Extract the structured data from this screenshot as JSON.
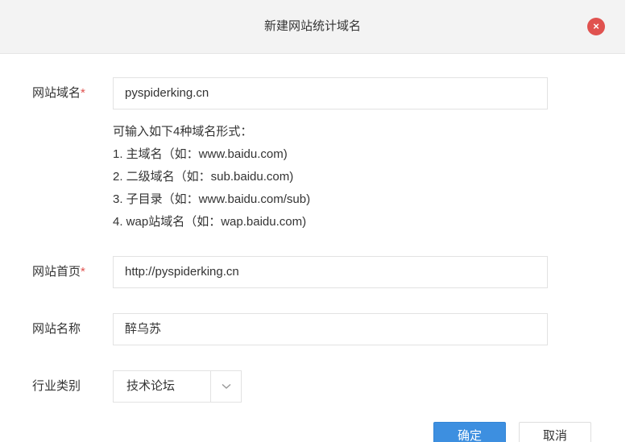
{
  "dialog": {
    "title": "新建网站统计域名",
    "close_label": "×"
  },
  "form": {
    "domain": {
      "label": "网站域名",
      "required_mark": "*",
      "value": "pyspiderking.cn"
    },
    "hint": {
      "heading": "可输入如下4种域名形式：",
      "lines": [
        "1. 主域名（如：www.baidu.com)",
        "2. 二级域名（如：sub.baidu.com)",
        "3. 子目录（如：www.baidu.com/sub)",
        "4. wap站域名（如：wap.baidu.com)"
      ]
    },
    "homepage": {
      "label": "网站首页",
      "required_mark": "*",
      "value": "http://pyspiderking.cn"
    },
    "site_name": {
      "label": "网站名称",
      "value": "醉乌苏"
    },
    "industry": {
      "label": "行业类别",
      "selected": "技术论坛"
    }
  },
  "buttons": {
    "ok_label": "确定",
    "cancel_label": "取消"
  },
  "colors": {
    "close": "#e0524f",
    "primary": "#3d8fe0",
    "required": "#e0524f"
  },
  "icons": {
    "close": "close-icon",
    "dropdown": "chevron-down-icon"
  }
}
